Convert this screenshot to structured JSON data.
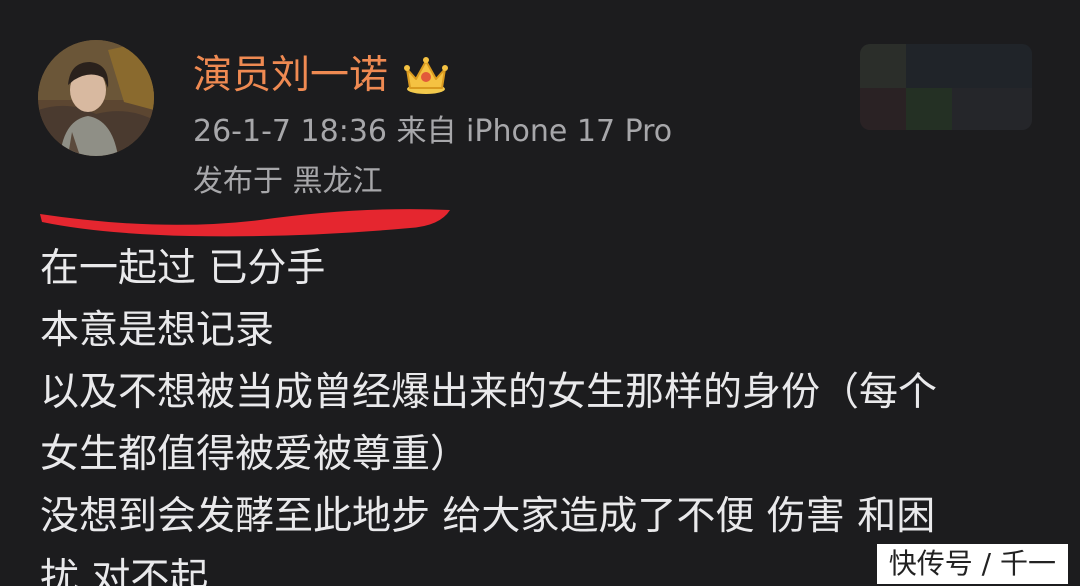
{
  "post": {
    "author": {
      "name": "演员刘一诺",
      "badge_icon": "crown-icon",
      "name_color": "#ef8a52"
    },
    "meta": {
      "datetime_source": "26-1-7 18:36 来自 iPhone 17 Pro",
      "location": "发布于 黑龙江"
    },
    "lines": [
      "在一起过 已分手",
      "本意是想记录",
      "以及不想被当成曾经爆出来的女生那样的身份（每个",
      "女生都值得被爱被尊重）",
      "没想到会发酵至此地步 给大家造成了不便 伤害 和困",
      "扰 对不起"
    ]
  },
  "annotation": {
    "type": "red-underline",
    "color": "#e5262f"
  },
  "watermark": {
    "text": "快传号 / 千一"
  },
  "colors": {
    "background": "#1c1c1e",
    "body_text": "#e9e9eb",
    "meta_text": "#a7a7aa"
  }
}
